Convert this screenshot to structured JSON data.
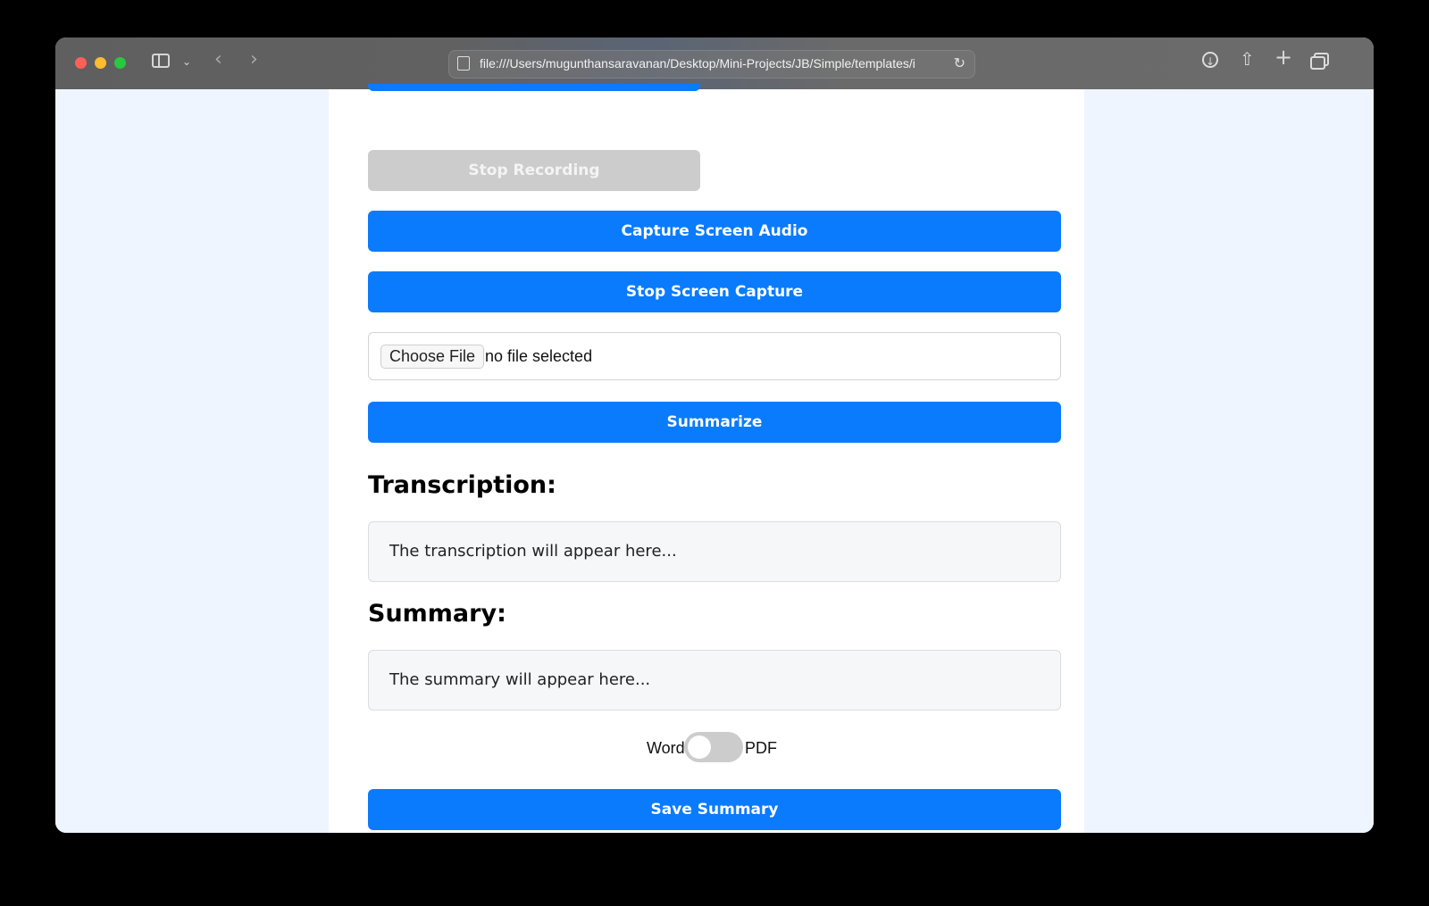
{
  "browser": {
    "url": "file:///Users/mugunthansaravanan/Desktop/Mini-Projects/JB/Simple/templates/i"
  },
  "page": {
    "stop_recording_label": "Stop Recording",
    "capture_screen_audio_label": "Capture Screen Audio",
    "stop_screen_capture_label": "Stop Screen Capture",
    "file_input": {
      "button_label": "Choose File",
      "status": "no file selected"
    },
    "summarize_label": "Summarize",
    "transcription_heading": "Transcription:",
    "transcription_placeholder": "The transcription will appear here...",
    "summary_heading": "Summary:",
    "summary_placeholder": "The summary will appear here...",
    "format_toggle": {
      "left_label": "Word",
      "right_label": "PDF",
      "checked": false
    },
    "save_summary_label": "Save Summary"
  },
  "colors": {
    "primary_button": "#0a7bfd",
    "disabled_button": "#cccccc",
    "page_background": "#eef5fe"
  }
}
